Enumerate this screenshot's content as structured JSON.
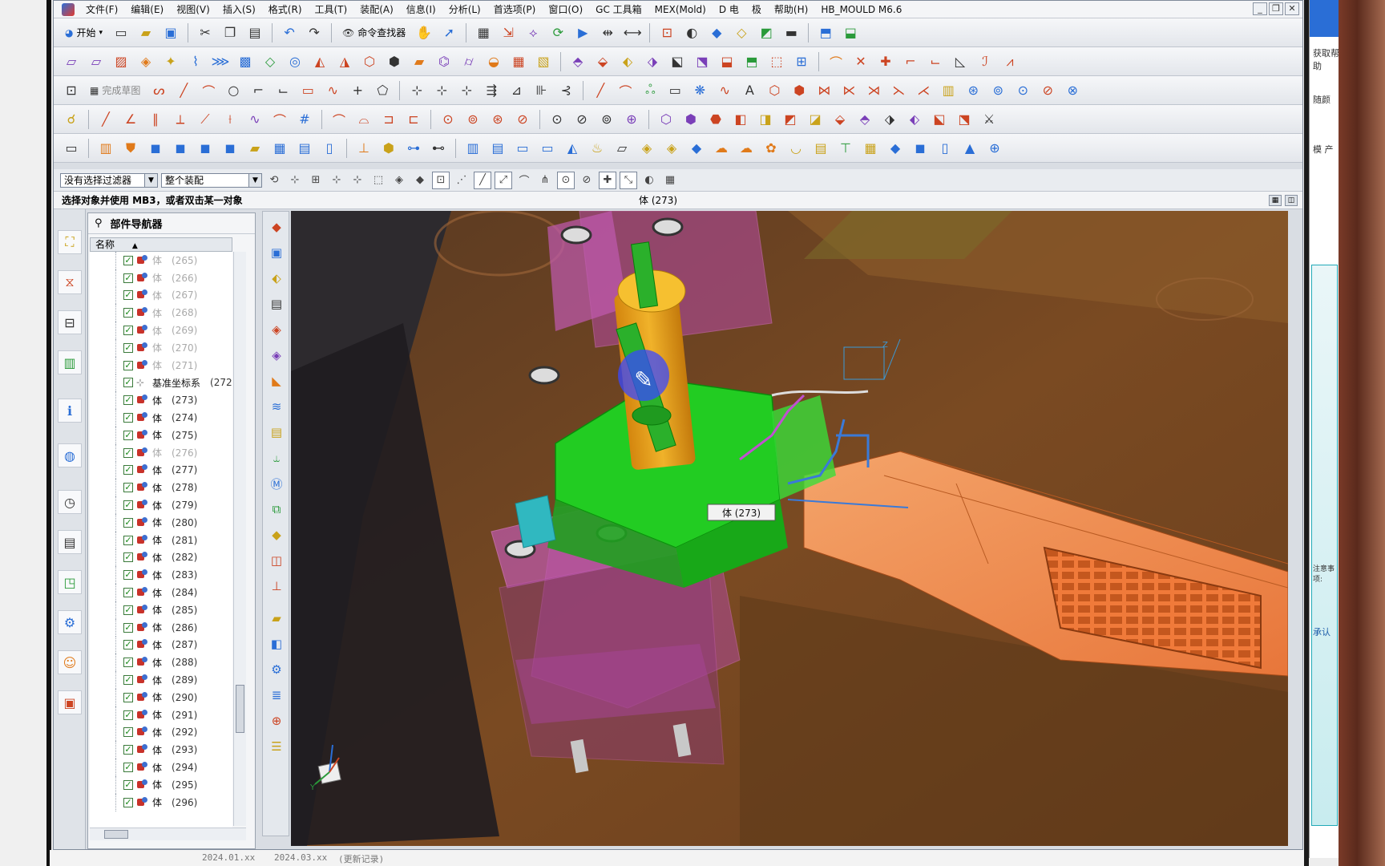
{
  "menubar": {
    "items": [
      "文件(F)",
      "编辑(E)",
      "视图(V)",
      "插入(S)",
      "格式(R)",
      "工具(T)",
      "装配(A)",
      "信息(I)",
      "分析(L)",
      "首选项(P)",
      "窗口(O)",
      "GC 工具箱",
      "MEX(Mold)",
      "D 电",
      "极",
      "帮助(H)",
      "HB_MOULD M6.6"
    ],
    "window_buttons": [
      "_",
      "❐",
      "✕"
    ]
  },
  "toolbar": {
    "start_label": "开始",
    "cmd_finder_label": "命令查找器",
    "sketch_done_label": "完成草图"
  },
  "filter": {
    "selection_filter": "没有选择过滤器",
    "assembly_scope": "整个装配"
  },
  "cue": {
    "message": "选择对象并使用 MB3，或者双击某一对象",
    "status": "体 (273)"
  },
  "navigator": {
    "title": "部件导航器",
    "column_name": "名称",
    "rows": [
      {
        "name": "体",
        "id": "(265)",
        "type": "body",
        "dim": true
      },
      {
        "name": "体",
        "id": "(266)",
        "type": "body",
        "dim": true
      },
      {
        "name": "体",
        "id": "(267)",
        "type": "body",
        "dim": true
      },
      {
        "name": "体",
        "id": "(268)",
        "type": "body",
        "dim": true
      },
      {
        "name": "体",
        "id": "(269)",
        "type": "body",
        "dim": true
      },
      {
        "name": "体",
        "id": "(270)",
        "type": "body",
        "dim": true
      },
      {
        "name": "体",
        "id": "(271)",
        "type": "body",
        "dim": true
      },
      {
        "name": "基准坐标系",
        "id": "(272",
        "type": "csys",
        "dim": false
      },
      {
        "name": "体",
        "id": "(273)",
        "type": "body",
        "dim": false
      },
      {
        "name": "体",
        "id": "(274)",
        "type": "body",
        "dim": false
      },
      {
        "name": "体",
        "id": "(275)",
        "type": "body",
        "dim": false
      },
      {
        "name": "体",
        "id": "(276)",
        "type": "body",
        "dim": true
      },
      {
        "name": "体",
        "id": "(277)",
        "type": "body",
        "dim": false
      },
      {
        "name": "体",
        "id": "(278)",
        "type": "body",
        "dim": false
      },
      {
        "name": "体",
        "id": "(279)",
        "type": "body",
        "dim": false
      },
      {
        "name": "体",
        "id": "(280)",
        "type": "body",
        "dim": false
      },
      {
        "name": "体",
        "id": "(281)",
        "type": "body",
        "dim": false
      },
      {
        "name": "体",
        "id": "(282)",
        "type": "body",
        "dim": false
      },
      {
        "name": "体",
        "id": "(283)",
        "type": "body",
        "dim": false
      },
      {
        "name": "体",
        "id": "(284)",
        "type": "body",
        "dim": false
      },
      {
        "name": "体",
        "id": "(285)",
        "type": "body",
        "dim": false
      },
      {
        "name": "体",
        "id": "(286)",
        "type": "body",
        "dim": false
      },
      {
        "name": "体",
        "id": "(287)",
        "type": "body",
        "dim": false
      },
      {
        "name": "体",
        "id": "(288)",
        "type": "body",
        "dim": false
      },
      {
        "name": "体",
        "id": "(289)",
        "type": "body",
        "dim": false
      },
      {
        "name": "体",
        "id": "(290)",
        "type": "body",
        "dim": false
      },
      {
        "name": "体",
        "id": "(291)",
        "type": "body",
        "dim": false
      },
      {
        "name": "体",
        "id": "(292)",
        "type": "body",
        "dim": false
      },
      {
        "name": "体",
        "id": "(293)",
        "type": "body",
        "dim": false
      },
      {
        "name": "体",
        "id": "(294)",
        "type": "body",
        "dim": false
      },
      {
        "name": "体",
        "id": "(295)",
        "type": "body",
        "dim": false
      },
      {
        "name": "体",
        "id": "(296)",
        "type": "body",
        "dim": false
      }
    ]
  },
  "viewport": {
    "hover_tag": "体 (273)",
    "triad_z": "Z",
    "triad_y": "Y",
    "colors": {
      "background": "#2d2a2e",
      "mold_base": "#7a4a22",
      "plates": "#b04a9a",
      "slider": "#22cc22",
      "pin": "#e8a21a",
      "part": "#f08a4a",
      "highlight": "#3a48ff"
    }
  },
  "side_app": {
    "labels": [
      "获取帮助",
      "随颜",
      "模 产",
      "承认",
      "注意事项:"
    ]
  },
  "bottom_bezel": {
    "labels": [
      "2024.01.xx",
      "2024.03.xx",
      "(更新记录)"
    ]
  }
}
